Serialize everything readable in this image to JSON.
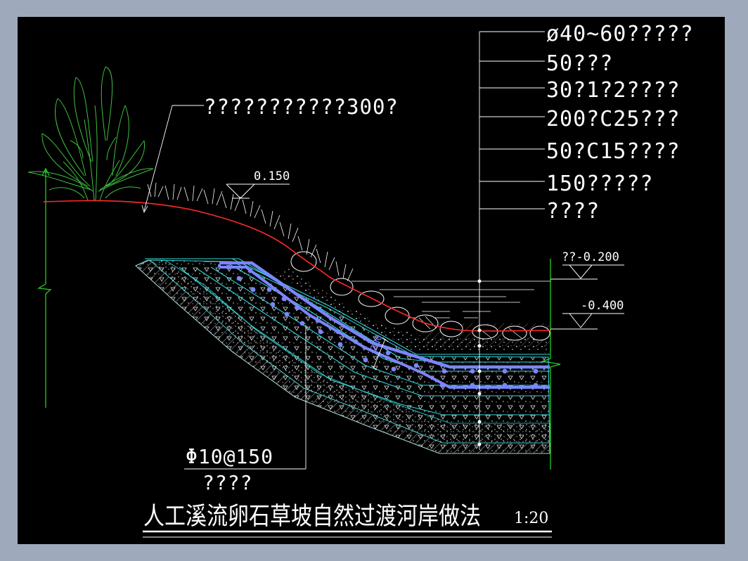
{
  "drawing": {
    "title": "人工溪流卵石草坡自然过渡河岸做法",
    "scale": "1:20"
  },
  "callouts": {
    "lawn_note": "???????????300?",
    "layers": [
      "ø40~60?????",
      "50???",
      "30?1?2????",
      "200?C25???",
      "50?C15????",
      "150?????",
      "????"
    ],
    "rebar": "Φ10@150",
    "rebar_sub": "????",
    "slab_dim": "200"
  },
  "elevations": {
    "bank_top": "0.150",
    "water_level": "??-0.200",
    "stream_bed": "-0.400"
  },
  "colors": {
    "background": "#000000",
    "frame": "#9ea9bb",
    "vegetation": "#3fbf3f",
    "grade_line": "#ff2a2a",
    "layer_lines": "#33d6d6",
    "rebar": "#7b86ff",
    "leader": "#ffffff",
    "break_line": "#23d023"
  }
}
